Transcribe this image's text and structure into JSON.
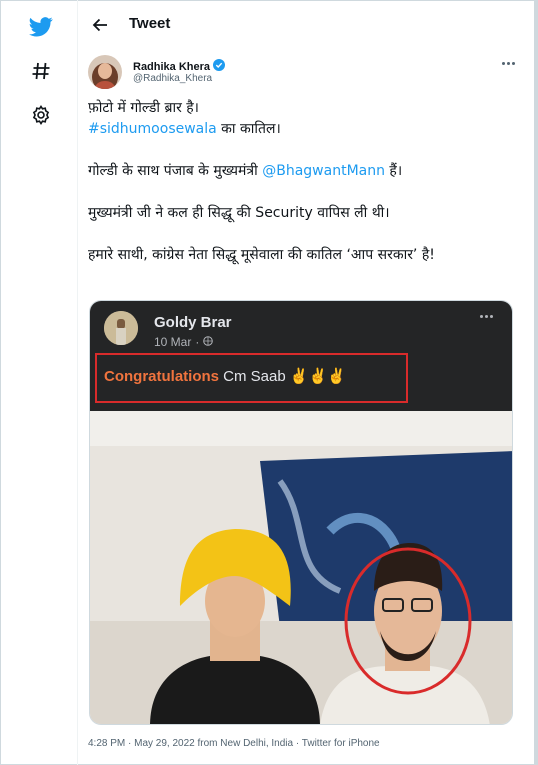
{
  "header": {
    "title": "Tweet"
  },
  "nav": {
    "icons": [
      "twitter-logo-icon",
      "hashtag-icon",
      "settings-gear-icon"
    ]
  },
  "author": {
    "name": "Radhika Khera",
    "handle": "@Radhika_Khera",
    "verified": true
  },
  "tweet": {
    "line1": "फ़ोटो में गोल्डी ब्रार है।",
    "hashtag": "#sidhumoosewala",
    "line2_rest": " का कातिल।",
    "para2_before": "गोल्डी के साथ पंजाब के मुख्यमंत्री ",
    "mention": "@BhagwantMann",
    "para2_after": " हैं।",
    "para3": "मुख्यमंत्री जी ने कल ही सिद्धू की Security वापिस ली थी।",
    "para4": "हमारे साथी, कांग्रेस नेता सिद्धू मूसेवाला की कातिल ‘आप सरकार’ है!"
  },
  "embedded_post": {
    "name": "Goldy Brar",
    "date": "10 Mar",
    "dot": "·",
    "text_highlight": "Congratulations",
    "text_rest": " Cm Saab ✌✌✌"
  },
  "footer": {
    "meta": "4:28 PM · May 29, 2022 from New Delhi, India · Twitter for iPhone"
  },
  "colors": {
    "accent": "#1d9bf0",
    "text": "#0f1419",
    "muted": "#536471",
    "highlight_red": "#d92b2b"
  }
}
